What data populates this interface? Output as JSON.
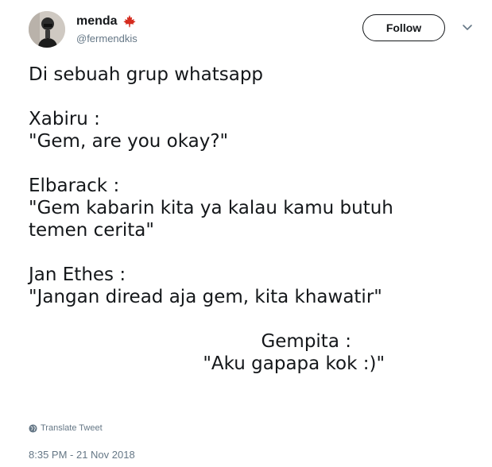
{
  "user": {
    "display_name": "menda",
    "handle": "@fermendkis",
    "badge_icon": "maple-leaf-icon",
    "badge_color": "#d52b1e"
  },
  "actions": {
    "follow_label": "Follow",
    "more_icon": "chevron-down-icon"
  },
  "tweet": {
    "lines": [
      "Di sebuah grup whatsapp",
      "",
      "Xabiru :",
      "\"Gem, are you okay?\"",
      "",
      "Elbarack :",
      "\"Gem kabarin kita ya kalau kamu butuh",
      "temen cerita\"",
      "",
      "Jan Ethes :",
      "\"Jangan diread aja gem, kita khawatir\"",
      "",
      "                                        Gempita :",
      "                              \"Aku gapapa kok :)\""
    ]
  },
  "footer": {
    "translate_label": "Translate Tweet",
    "translate_icon": "globe-icon",
    "timestamp": "8:35 PM - 21 Nov 2018"
  }
}
